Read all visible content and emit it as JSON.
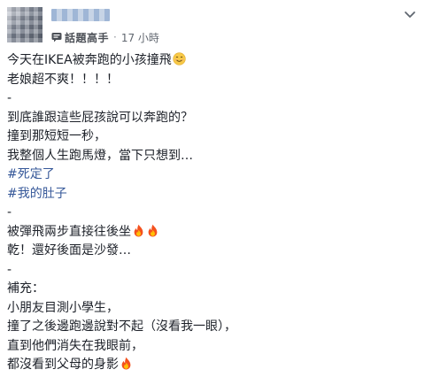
{
  "header": {
    "author_badge": "話題高手",
    "separator": "·",
    "timestamp": "17 小時"
  },
  "post_lines": [
    {
      "text": "今天在IKEA被奔跑的小孩撞飛",
      "emoji": [
        "smile"
      ],
      "tag": false
    },
    {
      "text": "老娘超不爽！！！！",
      "emoji": [],
      "tag": false
    },
    {
      "text": "-",
      "emoji": [],
      "tag": false
    },
    {
      "text": "到底誰跟這些屁孩說可以奔跑的？",
      "emoji": [],
      "tag": false
    },
    {
      "text": "撞到那短短一秒，",
      "emoji": [],
      "tag": false
    },
    {
      "text": "我整個人生跑馬燈，當下只想到…",
      "emoji": [],
      "tag": false
    },
    {
      "text": "#死定了",
      "emoji": [],
      "tag": true
    },
    {
      "text": "#我的肚子",
      "emoji": [],
      "tag": true
    },
    {
      "text": "-",
      "emoji": [],
      "tag": false
    },
    {
      "text": "被彈飛兩步直接往後坐",
      "emoji": [
        "fire",
        "fire"
      ],
      "tag": false
    },
    {
      "text": "乾！還好後面是沙發…",
      "emoji": [],
      "tag": false
    },
    {
      "text": "-",
      "emoji": [],
      "tag": false
    },
    {
      "text": "補充：",
      "emoji": [],
      "tag": false
    },
    {
      "text": "小朋友目測小學生，",
      "emoji": [],
      "tag": false
    },
    {
      "text": "撞了之後邊跑邊說對不起（沒看我一眼），",
      "emoji": [],
      "tag": false
    },
    {
      "text": "直到他們消失在我眼前，",
      "emoji": [],
      "tag": false
    },
    {
      "text": "都沒看到父母的身影",
      "emoji": [
        "fire"
      ],
      "tag": false
    }
  ],
  "colors": {
    "text": "#1d2129",
    "hashtag": "#365899",
    "meta": "#616770"
  }
}
